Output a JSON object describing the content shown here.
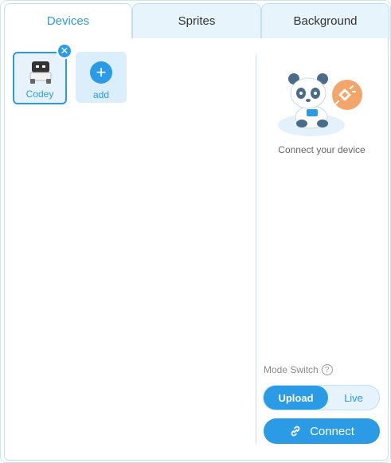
{
  "tabs": [
    {
      "label": "Devices",
      "active": true
    },
    {
      "label": "Sprites",
      "active": false
    },
    {
      "label": "Background",
      "active": false
    }
  ],
  "devices": [
    {
      "label": "Codey",
      "icon": "codey-robot-icon"
    }
  ],
  "add_tile": {
    "label": "add",
    "icon": "plus-icon"
  },
  "status": {
    "message": "Connect your device",
    "illustration": "panda-disconnected-icon"
  },
  "mode_switch": {
    "label": "Mode Switch",
    "options": [
      "Upload",
      "Live"
    ],
    "selected": "Upload"
  },
  "connect_button": {
    "label": "Connect",
    "icon": "link-icon"
  },
  "colors": {
    "accent": "#2b9be6",
    "tab_inactive_bg": "#e8f4fc",
    "border": "#bfe0f5",
    "disconnect_badge": "#f4a56a"
  }
}
